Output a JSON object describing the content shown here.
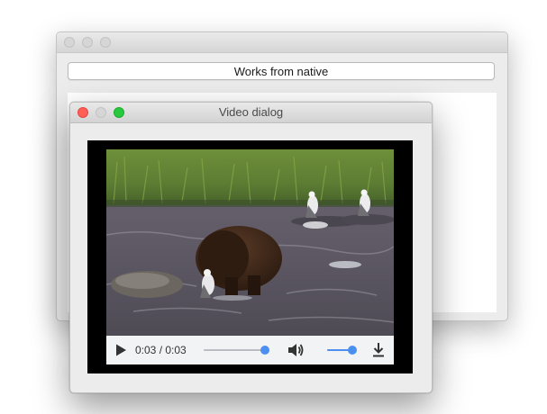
{
  "back_window": {
    "native_button_label": "Works from native"
  },
  "dialog": {
    "title": "Video dialog"
  },
  "player": {
    "current_time": "0:03",
    "duration": "0:03",
    "time_display": "0:03 / 0:03",
    "progress_fraction": 1.0,
    "volume_fraction": 1.0,
    "accent_color": "#4b8ff0",
    "icons": [
      "play-icon",
      "volume-icon",
      "download-icon"
    ]
  },
  "colors": {
    "close_light": "#ff5f57",
    "zoom_light": "#28c940",
    "control_bar": "#f1f3f4"
  }
}
